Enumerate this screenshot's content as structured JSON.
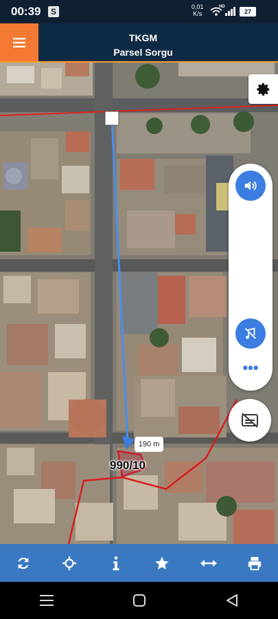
{
  "status_bar": {
    "time": "00:39",
    "badge": "S",
    "net_speed_value": "0,01",
    "net_speed_unit": "K/s",
    "network_type": "HD",
    "battery": "27"
  },
  "header": {
    "title": "TKGM",
    "subtitle": "Parsel Sorgu"
  },
  "map": {
    "distance_label": "190 m",
    "parcel_label": "990/10"
  },
  "colors": {
    "header_bg": "#0f2a44",
    "menu_bg": "#f47932",
    "toolbar_bg": "#3a78c2",
    "accent_blue": "#3b7de0",
    "route_line": "#4a8ef0",
    "boundary_red": "#e02020"
  },
  "toolbar": {
    "icons": [
      "refresh-icon",
      "crosshair-icon",
      "info-icon",
      "star-icon",
      "measure-icon",
      "print-icon"
    ]
  },
  "navbar": {
    "icons": [
      "recent-apps-icon",
      "home-icon",
      "back-icon"
    ]
  }
}
